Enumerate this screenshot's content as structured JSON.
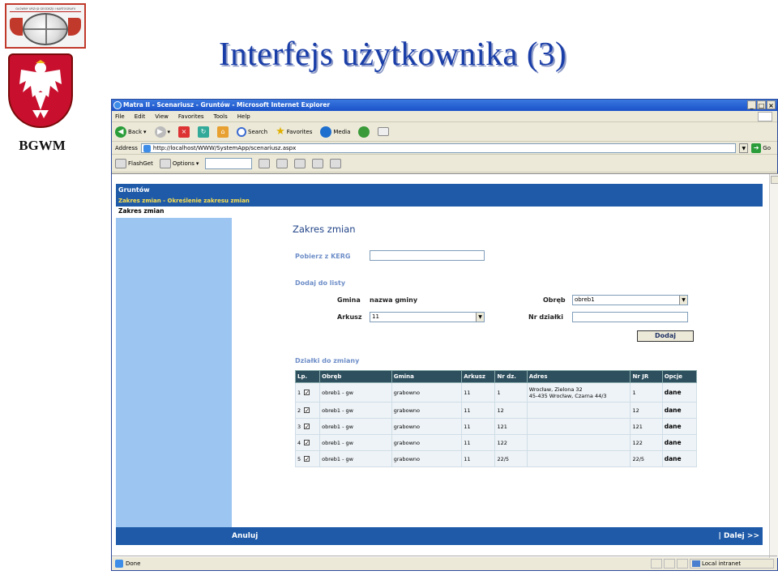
{
  "slide": {
    "title": "Interfejs użytkownika (3)",
    "org_label": "BGWM",
    "logo_text": "GŁÓWNY URZĄD GEODEZJI I KARTOGRAFII"
  },
  "browser": {
    "window_title": "Matra II - Scenariusz - Gruntów - Microsoft Internet Explorer",
    "menu": [
      "File",
      "Edit",
      "View",
      "Favorites",
      "Tools",
      "Help"
    ],
    "toolbar": {
      "back": "Back",
      "search": "Search",
      "favorites": "Favorites",
      "media": "Media"
    },
    "address_label": "Address",
    "address_value": "http://localhost/WWW/SystemApp/scenariusz.aspx",
    "go_label": "Go",
    "flashget": "FlashGet",
    "options": "Options",
    "status_text": "Done",
    "zone_text": "Local intranet"
  },
  "page": {
    "header_title": "Gruntów",
    "breadcrumb": "Zakres zmian - Określenie zakresu zmian",
    "sub_title": "Zakres zmian",
    "form_title": "Zakres zmian",
    "kerg_label": "Pobierz z KERG",
    "kerg_value": "",
    "add_section": "Dodaj do listy",
    "gmina_label": "Gmina",
    "gmina_value": "nazwa gminy",
    "obreb_label": "Obręb",
    "obreb_value": "obreb1",
    "arkusz_label": "Arkusz",
    "arkusz_value": "11",
    "nrdz_label": "Nr działki",
    "nrdz_value": "",
    "add_button": "Dodaj",
    "list_section": "Działki do zmiany",
    "columns": [
      "Lp.",
      "Obręb",
      "Gmina",
      "Arkusz",
      "Nr dz.",
      "Adres",
      "Nr JR",
      "Opcje"
    ],
    "rows": [
      {
        "lp": "1",
        "obreb": "obreb1 - gw",
        "gmina": "grabowno",
        "arkusz": "11",
        "nrdz": "1",
        "adres1": "Wrocław, Zielona 32",
        "adres2": "45-435 Wrocław, Czarna 44/3",
        "nrjr": "1",
        "opcje": "dane"
      },
      {
        "lp": "2",
        "obreb": "obreb1 - gw",
        "gmina": "grabowno",
        "arkusz": "11",
        "nrdz": "12",
        "adres1": "",
        "adres2": "",
        "nrjr": "12",
        "opcje": "dane"
      },
      {
        "lp": "3",
        "obreb": "obreb1 - gw",
        "gmina": "grabowno",
        "arkusz": "11",
        "nrdz": "121",
        "adres1": "",
        "adres2": "",
        "nrjr": "121",
        "opcje": "dane"
      },
      {
        "lp": "4",
        "obreb": "obreb1 - gw",
        "gmina": "grabowno",
        "arkusz": "11",
        "nrdz": "122",
        "adres1": "",
        "adres2": "",
        "nrjr": "122",
        "opcje": "dane"
      },
      {
        "lp": "5",
        "obreb": "obreb1 - gw",
        "gmina": "grabowno",
        "arkusz": "11",
        "nrdz": "22/5",
        "adres1": "",
        "adres2": "",
        "nrjr": "22/5",
        "opcje": "dane"
      }
    ],
    "cancel_label": "Anuluj",
    "next_label": "| Dalej >>"
  }
}
